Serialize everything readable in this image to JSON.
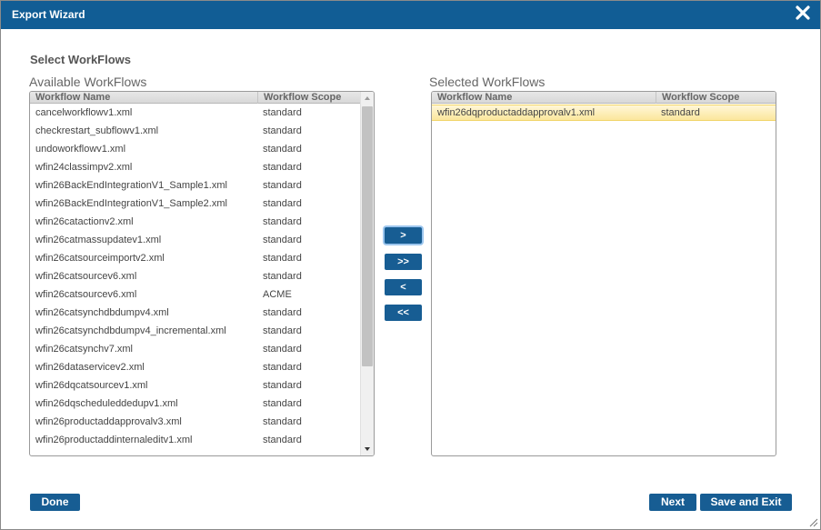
{
  "dialog": {
    "title": "Export Wizard",
    "close_icon": "close-icon"
  },
  "section_title": "Select WorkFlows",
  "available": {
    "label": "Available WorkFlows",
    "columns": [
      "Workflow Name",
      "Workflow Scope"
    ],
    "rows": [
      {
        "name": "cancelworkflowv1.xml",
        "scope": "standard"
      },
      {
        "name": "checkrestart_subflowv1.xml",
        "scope": "standard"
      },
      {
        "name": "undoworkflowv1.xml",
        "scope": "standard"
      },
      {
        "name": "wfin24classimpv2.xml",
        "scope": "standard"
      },
      {
        "name": "wfin26BackEndIntegrationV1_Sample1.xml",
        "scope": "standard"
      },
      {
        "name": "wfin26BackEndIntegrationV1_Sample2.xml",
        "scope": "standard"
      },
      {
        "name": "wfin26catactionv2.xml",
        "scope": "standard"
      },
      {
        "name": "wfin26catmassupdatev1.xml",
        "scope": "standard"
      },
      {
        "name": "wfin26catsourceimportv2.xml",
        "scope": "standard"
      },
      {
        "name": "wfin26catsourcev6.xml",
        "scope": "standard"
      },
      {
        "name": "wfin26catsourcev6.xml",
        "scope": "ACME"
      },
      {
        "name": "wfin26catsynchdbdumpv4.xml",
        "scope": "standard"
      },
      {
        "name": "wfin26catsynchdbdumpv4_incremental.xml",
        "scope": "standard"
      },
      {
        "name": "wfin26catsynchv7.xml",
        "scope": "standard"
      },
      {
        "name": "wfin26dataservicev2.xml",
        "scope": "standard"
      },
      {
        "name": "wfin26dqcatsourcev1.xml",
        "scope": "standard"
      },
      {
        "name": "wfin26dqscheduleddedupv1.xml",
        "scope": "standard"
      },
      {
        "name": "wfin26productaddapprovalv3.xml",
        "scope": "standard"
      },
      {
        "name": "wfin26productaddinternaleditv1.xml",
        "scope": "standard"
      }
    ]
  },
  "selected": {
    "label": "Selected WorkFlows",
    "columns": [
      "Workflow Name",
      "Workflow Scope"
    ],
    "rows": [
      {
        "name": "wfin26dqproductaddapprovalv1.xml",
        "scope": "standard"
      }
    ]
  },
  "move_buttons": [
    ">",
    ">>",
    "<",
    "<<"
  ],
  "footer": {
    "done": "Done",
    "next": "Next",
    "save_exit": "Save and Exit"
  },
  "colors": {
    "brand": "#115d95",
    "selection": "#fbe79c"
  }
}
